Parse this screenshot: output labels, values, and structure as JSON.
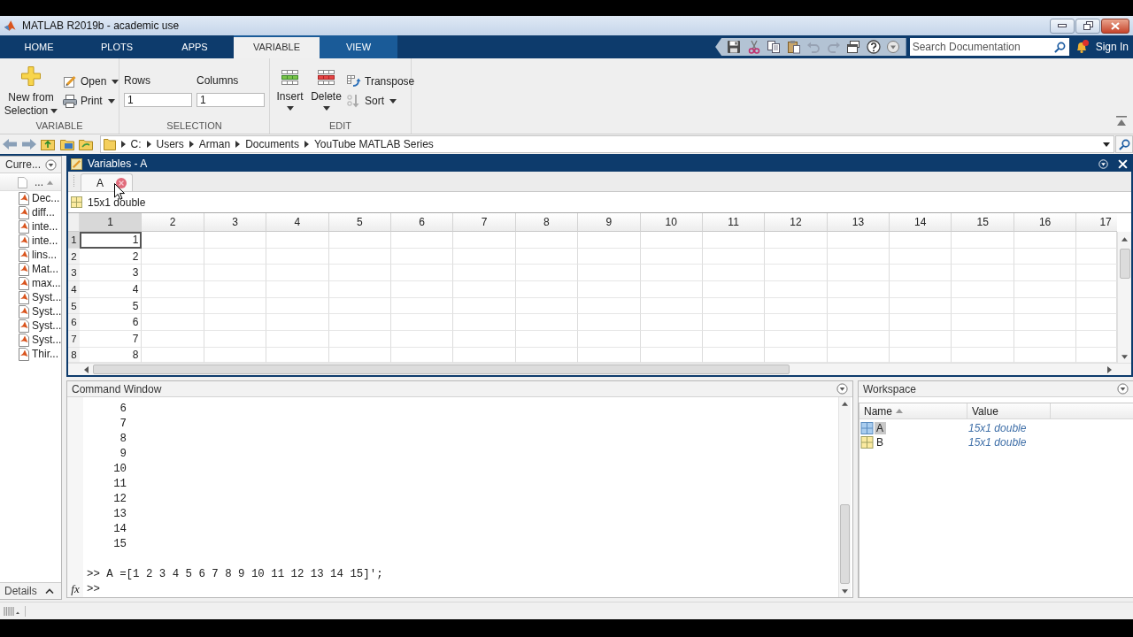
{
  "window": {
    "title": "MATLAB R2019b - academic use"
  },
  "tabs": [
    {
      "label": "HOME",
      "selected": false,
      "contextual": false
    },
    {
      "label": "PLOTS",
      "selected": false,
      "contextual": false
    },
    {
      "label": "APPS",
      "selected": false,
      "contextual": false
    },
    {
      "label": "VARIABLE",
      "selected": true,
      "contextual": true
    },
    {
      "label": "VIEW",
      "selected": false,
      "contextual": true
    }
  ],
  "quick_access": [
    {
      "kind": "save",
      "disabled": false
    },
    {
      "kind": "cut",
      "disabled": false
    },
    {
      "kind": "copy",
      "disabled": false
    },
    {
      "kind": "paste",
      "disabled": false
    },
    {
      "kind": "undo",
      "disabled": true
    },
    {
      "kind": "redo",
      "disabled": true
    },
    {
      "kind": "windows",
      "disabled": false
    },
    {
      "kind": "help",
      "disabled": false
    },
    {
      "kind": "more",
      "disabled": false
    }
  ],
  "search": {
    "placeholder": "Search Documentation"
  },
  "sign_in": "Sign In",
  "ribbon": {
    "variable": {
      "title": "VARIABLE",
      "new_from_selection": "New from Selection",
      "open": "Open",
      "print": "Print"
    },
    "selection": {
      "title": "SELECTION",
      "rows_label": "Rows",
      "rows_value": "1",
      "columns_label": "Columns",
      "columns_value": "1"
    },
    "edit": {
      "title": "EDIT",
      "insert": "Insert",
      "delete": "Delete",
      "transpose": "Transpose",
      "sort": "Sort"
    }
  },
  "address_bar": {
    "path": [
      "C:",
      "Users",
      "Arman",
      "Documents",
      "YouTube MATLAB Series"
    ]
  },
  "current_folder": {
    "title": "Curre...",
    "column_header": "...",
    "files": [
      "Dec...",
      "diff...",
      "inte...",
      "inte...",
      "lins...",
      "Mat...",
      "max...",
      "Syst...",
      "Syst...",
      "Syst...",
      "Syst...",
      "Thir..."
    ],
    "details": "Details"
  },
  "variables": {
    "title": "Variables - A",
    "tabs": [
      {
        "label": "A",
        "selected": true
      }
    ],
    "summary": "15x1 double",
    "columns": [
      "1",
      "2",
      "3",
      "4",
      "5",
      "6",
      "7",
      "8",
      "9",
      "10",
      "11",
      "12",
      "13",
      "14",
      "15",
      "16",
      "17"
    ],
    "rows": [
      {
        "label": "1",
        "cells": [
          {
            "value": "1",
            "selected": true
          }
        ]
      },
      {
        "label": "2",
        "cells": [
          {
            "value": "2",
            "selected": false
          }
        ]
      },
      {
        "label": "3",
        "cells": [
          {
            "value": "3",
            "selected": false
          }
        ]
      },
      {
        "label": "4",
        "cells": [
          {
            "value": "4",
            "selected": false
          }
        ]
      },
      {
        "label": "5",
        "cells": [
          {
            "value": "5",
            "selected": false
          }
        ]
      },
      {
        "label": "6",
        "cells": [
          {
            "value": "6",
            "selected": false
          }
        ]
      },
      {
        "label": "7",
        "cells": [
          {
            "value": "7",
            "selected": false
          }
        ]
      },
      {
        "label": "8",
        "cells": [
          {
            "value": "8",
            "selected": false
          }
        ]
      }
    ]
  },
  "command_window": {
    "title": "Command Window",
    "output": [
      "6",
      "7",
      "8",
      "9",
      "10",
      "11",
      "12",
      "13",
      "14",
      "15"
    ],
    "history": [
      {
        "prompt": ">>",
        "command": "A =[1 2 3 4 5 6 7 8 9 10 11 12 13 14 15]';"
      }
    ],
    "fx": "fx",
    "prompt": ">>"
  },
  "workspace": {
    "title": "Workspace",
    "columns": [
      {
        "label": "Name",
        "sorted": true
      },
      {
        "label": "Value",
        "sorted": false
      }
    ],
    "variables": [
      {
        "name": "A",
        "value": "15x1 double",
        "selected": true
      },
      {
        "name": "B",
        "value": "15x1 double",
        "selected": false
      }
    ]
  }
}
